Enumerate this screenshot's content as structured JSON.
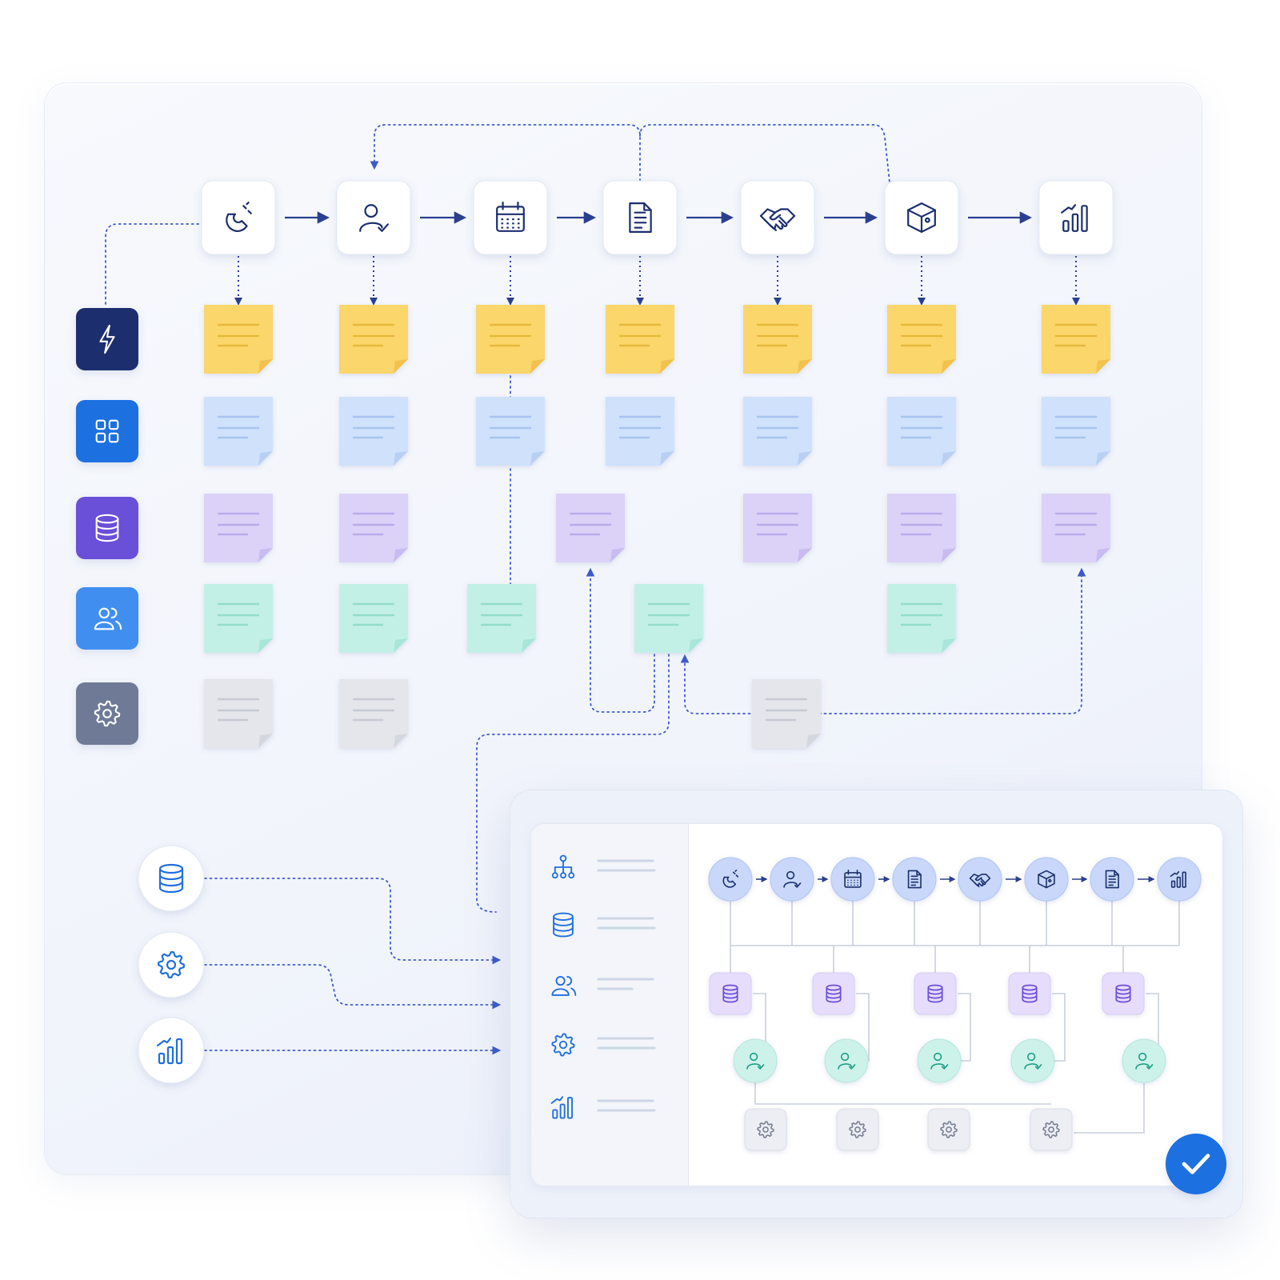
{
  "colors": {
    "navy": "#1b2f6e",
    "arrow": "#2b3f8f",
    "dotted": "#3d5bc7",
    "accent_blue": "#1f6fe0",
    "sticky_yellow": "#fbd66a",
    "sticky_blue": "#cfe1fb",
    "sticky_purple": "#dcd2f7",
    "sticky_teal": "#c3f0e6",
    "sticky_gray": "#e4e6ec",
    "check": "#1f6fe0"
  },
  "stages": [
    {
      "icon": "magnet-icon"
    },
    {
      "icon": "user-check-icon"
    },
    {
      "icon": "calendar-icon"
    },
    {
      "icon": "document-icon"
    },
    {
      "icon": "handshake-icon"
    },
    {
      "icon": "package-icon"
    },
    {
      "icon": "bar-chart-icon"
    }
  ],
  "lanes": [
    {
      "icon": "lightning-icon",
      "color": "#1b2f6e"
    },
    {
      "icon": "grid-icon",
      "color": "#1f6fe0"
    },
    {
      "icon": "database-icon",
      "color": "#6a4fd8"
    },
    {
      "icon": "users-icon",
      "color": "#3f8ff0"
    },
    {
      "icon": "gear-icon",
      "color": "#6e7a96"
    }
  ],
  "stickies": [
    {
      "lane": 0,
      "color": "yellow",
      "positions": [
        0,
        1,
        2,
        3,
        4,
        5,
        6
      ]
    },
    {
      "lane": 1,
      "color": "blue",
      "positions": [
        0,
        1,
        2,
        3,
        4,
        5,
        6
      ]
    },
    {
      "lane": 2,
      "color": "purple",
      "positions": [
        0,
        1,
        "3b",
        4,
        5,
        6
      ]
    },
    {
      "lane": 3,
      "color": "teal",
      "positions": [
        0,
        1,
        "2b",
        "3c",
        5
      ]
    },
    {
      "lane": 4,
      "color": "gray",
      "positions": [
        0,
        1,
        "4b"
      ]
    }
  ],
  "integrations": [
    {
      "icon": "database-icon"
    },
    {
      "icon": "gear-icon"
    },
    {
      "icon": "bar-chart-icon"
    }
  ],
  "panel": {
    "sidebar_items": [
      {
        "icon": "hierarchy-icon"
      },
      {
        "icon": "database-icon"
      },
      {
        "icon": "users-icon"
      },
      {
        "icon": "gear-icon"
      },
      {
        "icon": "bar-chart-icon"
      }
    ],
    "flow_nodes": [
      {
        "icon": "magnet-icon"
      },
      {
        "icon": "user-check-icon"
      },
      {
        "icon": "calendar-icon"
      },
      {
        "icon": "document-icon"
      },
      {
        "icon": "handshake-icon"
      },
      {
        "icon": "package-icon"
      },
      {
        "icon": "document-icon"
      },
      {
        "icon": "bar-chart-icon"
      }
    ],
    "db_nodes": 5,
    "user_nodes": 5,
    "gear_nodes": 4
  },
  "status": {
    "icon": "checkmark-icon"
  }
}
